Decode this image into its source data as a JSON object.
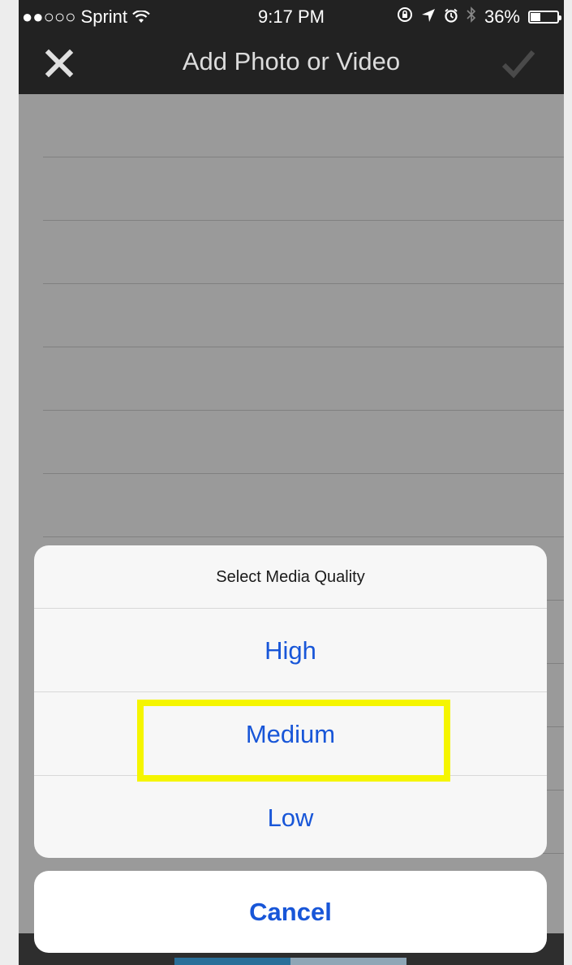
{
  "status_bar": {
    "carrier": "●●○○○ Sprint",
    "wifi_icon": "wifi-icon",
    "time": "9:17 PM",
    "icons": [
      "rotation-lock-icon",
      "location-icon",
      "alarm-icon",
      "bluetooth-icon"
    ],
    "battery_percent_label": "36%",
    "battery_level": 0.36
  },
  "nav_bar": {
    "title": "Add Photo or Video",
    "close_icon": "close-icon",
    "done_icon": "checkmark-icon"
  },
  "action_sheet": {
    "title": "Select Media Quality",
    "options": [
      {
        "label": "High"
      },
      {
        "label": "Medium",
        "highlighted": true
      },
      {
        "label": "Low"
      }
    ],
    "cancel_label": "Cancel"
  },
  "colors": {
    "action_text": "#1856d8",
    "highlight_box": "#f5f500",
    "bar_background": "#222222",
    "dimmed_background": "#9a9a9a"
  }
}
